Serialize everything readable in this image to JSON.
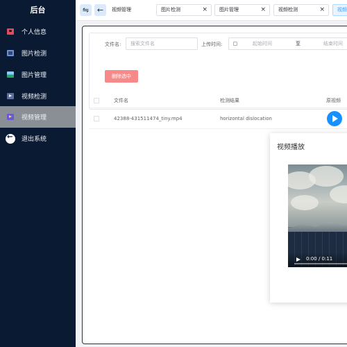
{
  "sidebar": {
    "brand": "后台",
    "items": [
      {
        "label": "个人信息",
        "icon": "user-card-icon"
      },
      {
        "label": "图片检测",
        "icon": "image-detect-icon"
      },
      {
        "label": "图片管理",
        "icon": "image-manage-icon"
      },
      {
        "label": "视频检测",
        "icon": "video-detect-icon"
      },
      {
        "label": "视频管理",
        "icon": "video-manage-icon",
        "active": true
      },
      {
        "label": "退出系统",
        "icon": "logout-icon"
      }
    ]
  },
  "topbar": {
    "breadcrumb": "视频管理",
    "tabs": [
      {
        "label": "图片检测"
      },
      {
        "label": "图片管理"
      },
      {
        "label": "视频检测"
      },
      {
        "label": "视频",
        "active": true
      }
    ]
  },
  "search": {
    "filename_label": "文件名:",
    "filename_placeholder": "搜索文件名",
    "upload_time_label": "上传时间:",
    "start_placeholder": "起始时间",
    "range_separator": "至",
    "end_placeholder": "结束时间",
    "delete_button": "删除选中"
  },
  "table": {
    "headers": [
      "文件名",
      "检测结果",
      "原视频"
    ],
    "rows": [
      {
        "filename": "42388-431511474_tiny.mp4",
        "result": "horizontal dislocation"
      }
    ]
  },
  "dialog": {
    "title": "视频播放",
    "video_time": "0:00 / 0:11"
  },
  "colors": {
    "sidebar_bg": "#0b1a33",
    "active_menu_bg": "#8a8f96",
    "delete_button": "#f78989",
    "play_button": "#1890ff"
  }
}
